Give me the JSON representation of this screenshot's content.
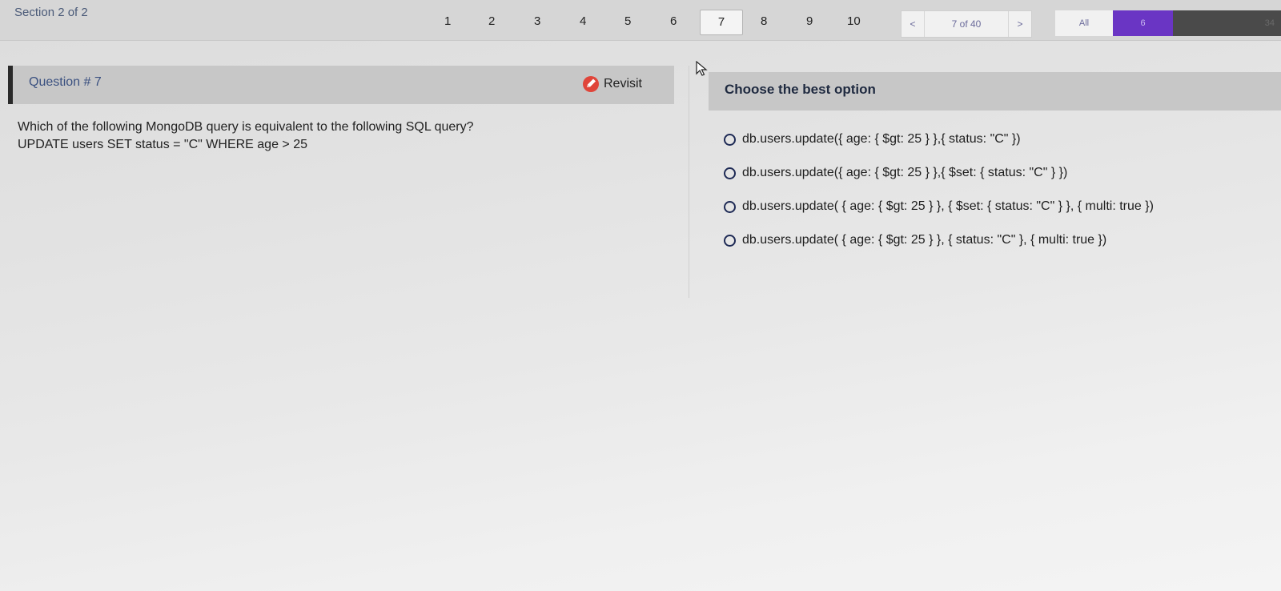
{
  "nav": {
    "section_label": "Section 2 of 2",
    "questions": [
      "1",
      "2",
      "3",
      "4",
      "5",
      "6",
      "7",
      "8",
      "9",
      "10"
    ],
    "current": "7",
    "pager": {
      "prev": "<",
      "count": "7 of 40",
      "next": ">"
    },
    "filters": {
      "all": "All",
      "count": "6",
      "dark": "34"
    }
  },
  "question": {
    "title": "Question # 7",
    "revisit_label": "Revisit",
    "text_line1": "Which of the following MongoDB query is equivalent to the following SQL query?",
    "text_line2": "UPDATE users SET status = \"C\" WHERE age > 25"
  },
  "answers": {
    "header": "Choose the best option",
    "options": [
      "db.users.update({ age: { $gt: 25 } },{ status: \"C\" })",
      "db.users.update({ age: { $gt: 25 } },{ $set: { status: \"C\" } })",
      "db.users.update( { age: { $gt: 25 } }, { $set: { status: \"C\" } }, { multi: true })",
      "db.users.update( { age: { $gt: 25 } }, { status: \"C\" }, { multi: true })"
    ]
  },
  "colors": {
    "accent_purple": "#6a35c4",
    "revisit_red": "#e0453a"
  }
}
